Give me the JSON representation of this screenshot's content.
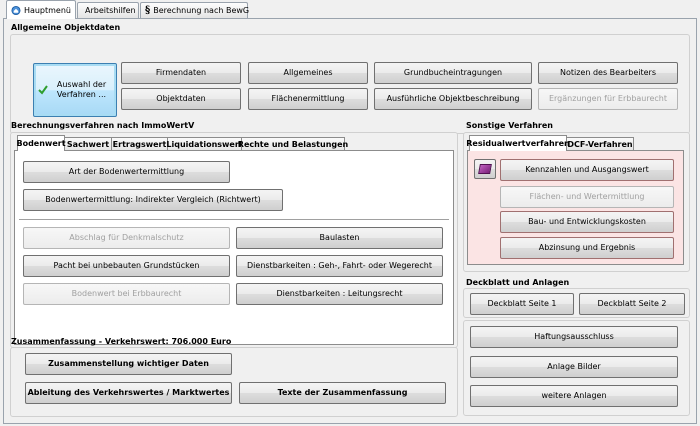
{
  "tabs": [
    {
      "label": "Hauptmenü",
      "icon": "home-icon"
    },
    {
      "label": "Arbeitshilfen",
      "icon": "folder-icon"
    },
    {
      "label": "Berechnung nach BewG",
      "icon": "paragraph-icon"
    }
  ],
  "objektdaten": {
    "title": "Allgemeine Objektdaten",
    "select_button": "Auswahl der Verfahren ...",
    "buttons": [
      "Firmendaten",
      "Allgemeines",
      "Grundbucheintragungen",
      "Notizen des Bearbeiters",
      "Objektdaten",
      "Flächenermittlung",
      "Ausführliche Objektbeschreibung",
      "Ergänzungen für Erbbaurecht"
    ]
  },
  "berechnung": {
    "title": "Berechnungsverfahren nach ImmoWertV",
    "tabs": [
      "Bodenwert",
      "Sachwert",
      "Ertragswert",
      "Liquidationswert",
      "Rechte und Belastungen"
    ],
    "buttons": [
      "Art der Bodenwertermittlung",
      "Bodenwertermittlung: Indirekter Vergleich (Richtwert)",
      "Abschlag für Denkmalschutz",
      "Baulasten",
      "Pacht bei unbebauten Grundstücken",
      "Dienstbarkeiten : Geh-, Fahrt- oder Wegerecht",
      "Bodenwert bei Erbbaurecht",
      "Dienstbarkeiten : Leitungsrecht"
    ]
  },
  "sonstige": {
    "title": "Sonstige Verfahren",
    "tabs": [
      "Residualwertverfahren",
      "DCF-Verfahren"
    ],
    "buttons": [
      "Kennzahlen und Ausgangswert",
      "Flächen- und Wertermittlung",
      "Bau- und Entwicklungskosten",
      "Abzinsung und Ergebnis"
    ]
  },
  "zusammenfassung": {
    "title": "Zusammenfassung - Verkehrswert: 706.000 Euro",
    "buttons": [
      "Zusammenstellung wichtiger Daten",
      "Ableitung des Verkehrswertes / Marktwertes",
      "Texte der Zusammenfassung"
    ]
  },
  "deckblatt": {
    "title": "Deckblatt und Anlagen",
    "buttons": [
      "Deckblatt Seite 1",
      "Deckblatt Seite 2",
      "Haftungsausschluss",
      "Anlage Bilder",
      "weitere Anlagen"
    ]
  }
}
